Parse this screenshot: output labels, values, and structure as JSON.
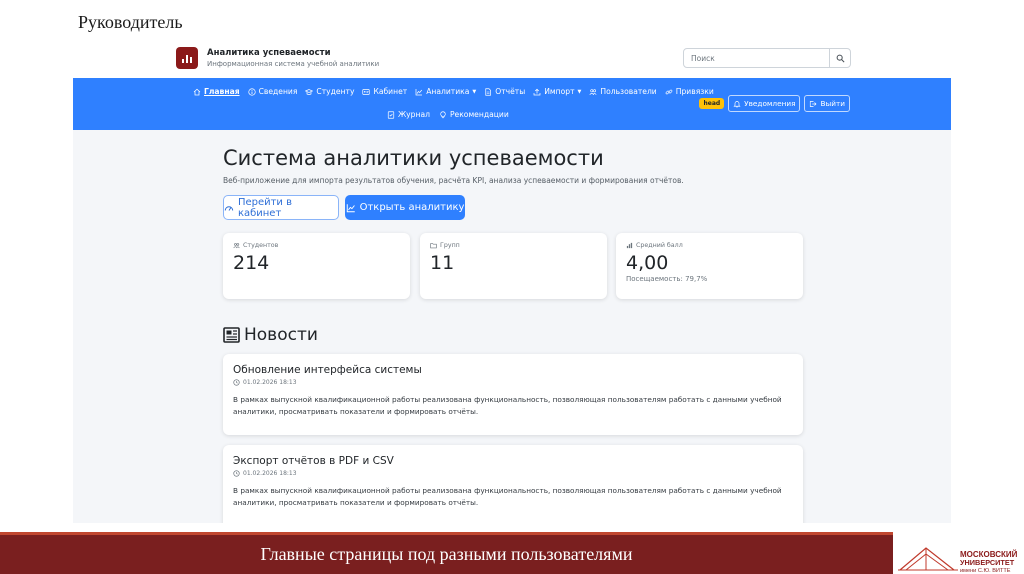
{
  "slide": {
    "title": "Руководитель",
    "footer": "Главные страницы под разными пользователями",
    "university_logo_text": "МОСКОВСКИЙ УНИВЕРСИТЕТ имени С.Ю. ВИТТЕ",
    "footer_color": "#7a1f1f"
  },
  "brand": {
    "name": "Аналитика успеваемости",
    "subtitle": "Информационная система учебной аналитики",
    "logo_icon": "bar-chart-icon",
    "logo_color": "#8b1a1a"
  },
  "search": {
    "placeholder": "Поиск"
  },
  "nav": {
    "color": "#2f80ff",
    "items": [
      {
        "label": "Главная",
        "icon": "home-icon",
        "active": true
      },
      {
        "label": "Сведения",
        "icon": "info-icon"
      },
      {
        "label": "Студенту",
        "icon": "student-icon"
      },
      {
        "label": "Кабинет",
        "icon": "id-card-icon"
      },
      {
        "label": "Аналитика",
        "icon": "chart-line-icon",
        "dropdown": true
      },
      {
        "label": "Отчёты",
        "icon": "file-icon"
      },
      {
        "label": "Импорт",
        "icon": "upload-icon",
        "dropdown": true
      },
      {
        "label": "Пользователи",
        "icon": "users-icon"
      },
      {
        "label": "Привязки",
        "icon": "link-icon"
      },
      {
        "label": "Журнал",
        "icon": "journal-icon"
      },
      {
        "label": "Рекомендации",
        "icon": "lightbulb-icon"
      }
    ],
    "role_badge": "head",
    "notifications": "Уведомления",
    "logout": "Выйти"
  },
  "hero": {
    "title": "Система аналитики успеваемости",
    "subtitle": "Веб-приложение для импорта результатов обучения, расчёта KPI, анализа успеваемости и формирования отчётов.",
    "btn_cabinet": "Перейти в кабинет",
    "btn_analytics": "Открыть аналитику"
  },
  "stats": [
    {
      "label": "Студентов",
      "value": "214",
      "icon": "users-icon"
    },
    {
      "label": "Групп",
      "value": "11",
      "icon": "folder-icon"
    },
    {
      "label": "Средний балл",
      "value": "4,00",
      "note": "Посещаемость: 79,7%",
      "icon": "bar-chart-icon"
    }
  ],
  "news": {
    "title": "Новости",
    "items": [
      {
        "title": "Обновление интерфейса системы",
        "date": "01.02.2026 18:13",
        "body": "В рамках выпускной квалификационной работы реализована функциональность, позволяющая пользователям работать с данными учебной аналитики, просматривать показатели и формировать отчёты."
      },
      {
        "title": "Экспорт отчётов в PDF и CSV",
        "date": "01.02.2026 18:13",
        "body": "В рамках выпускной квалификационной работы реализована функциональность, позволяющая пользователям работать с данными учебной аналитики, просматривать показатели и формировать отчёты."
      }
    ]
  }
}
